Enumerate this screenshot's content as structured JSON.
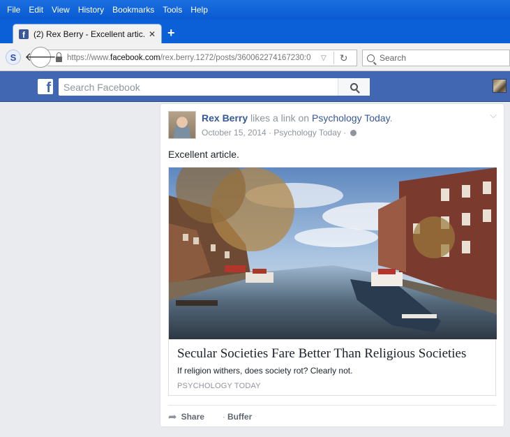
{
  "menu": [
    "File",
    "Edit",
    "View",
    "History",
    "Bookmarks",
    "Tools",
    "Help"
  ],
  "tab": {
    "title": "(2) Rex Berry - Excellent artic...",
    "close": "✕",
    "favicon": "f"
  },
  "newtab": "+",
  "nav": {
    "back_glyph": "🡐",
    "s_logo": "S",
    "url_prefix": "https://www.",
    "url_domain": "facebook.com",
    "url_path": "/rex.berry.1272/posts/360062274167230:0",
    "dropdown": "▽",
    "reload": "↻",
    "search_placeholder": "Search"
  },
  "facebook": {
    "logo": "f",
    "search_placeholder": "Search Facebook"
  },
  "post": {
    "author": "Rex Berry",
    "action": " likes a link on ",
    "page": "Psychology Today",
    "period": ".",
    "meta": "October 15, 2014 · Psychology Today · ",
    "chevron": "⌵",
    "text": "Excellent article.",
    "link": {
      "title": "Secular Societies Fare Better Than Religious Societies",
      "description": "If religion withers, does society rot? Clearly not.",
      "source": "PSYCHOLOGY TODAY"
    },
    "actions": {
      "share_icon": "➦",
      "share": "Share",
      "buffer": "Buffer"
    }
  }
}
